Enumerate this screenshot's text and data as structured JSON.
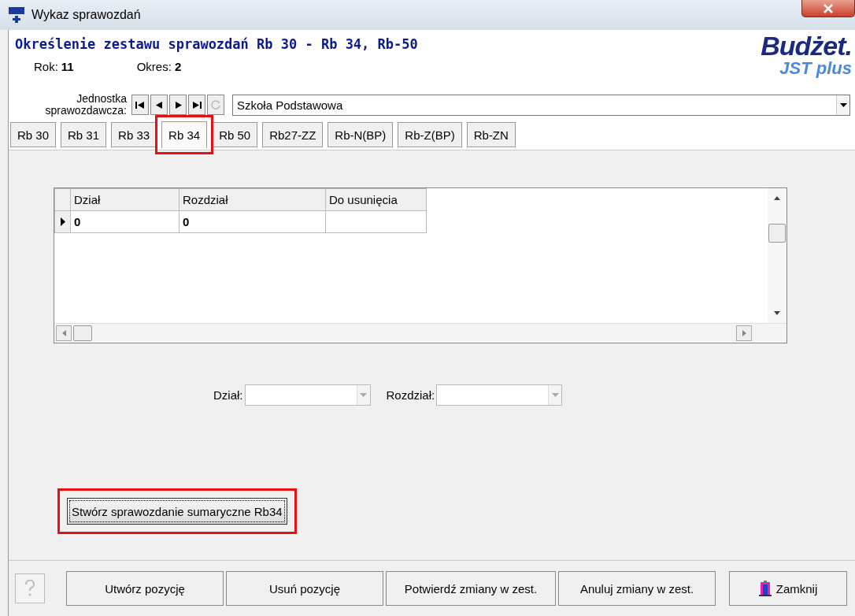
{
  "window": {
    "title": "Wykaz sprawozdań"
  },
  "header": {
    "title": "Określenie zestawu sprawozdań Rb 30 - Rb 34, Rb-50",
    "logo_main": "Budżet.",
    "logo_sub": "JST plus",
    "year_label": "Rok:",
    "year": "11",
    "period_label": "Okres:",
    "period": "2"
  },
  "unit": {
    "label": "Jednostka sprawozdawcza:",
    "value": "Szkoła Podstawowa"
  },
  "tabs": [
    {
      "label": "Rb 30",
      "selected": false,
      "highlighted": false
    },
    {
      "label": "Rb 31",
      "selected": false,
      "highlighted": false
    },
    {
      "label": "Rb 33",
      "selected": false,
      "highlighted": false
    },
    {
      "label": "Rb 34",
      "selected": true,
      "highlighted": true
    },
    {
      "label": "Rb 50",
      "selected": false,
      "highlighted": false
    },
    {
      "label": "Rb27-ZZ",
      "selected": false,
      "highlighted": false
    },
    {
      "label": "Rb-N(BP)",
      "selected": false,
      "highlighted": false
    },
    {
      "label": "Rb-Z(BP)",
      "selected": false,
      "highlighted": false
    },
    {
      "label": "Rb-ZN",
      "selected": false,
      "highlighted": false
    }
  ],
  "table": {
    "columns": [
      "Dział",
      "Rozdział",
      "Do usunięcia"
    ],
    "rows": [
      {
        "cells": [
          "0",
          "0",
          ""
        ],
        "selected": true
      }
    ]
  },
  "filters": [
    {
      "label": "Dział:"
    },
    {
      "label": "Rozdział:"
    }
  ],
  "summary_button": {
    "label": "Stwórz sprawozdanie sumaryczne Rb34",
    "highlighted": true
  },
  "buttons": [
    {
      "label": "Utwórz pozycję"
    },
    {
      "label": "Usuń pozycję"
    },
    {
      "label": "Potwierdź zmiany w zest."
    },
    {
      "label": "Anuluj zmiany w zest."
    }
  ],
  "close_button": {
    "label": "Zamknij"
  }
}
